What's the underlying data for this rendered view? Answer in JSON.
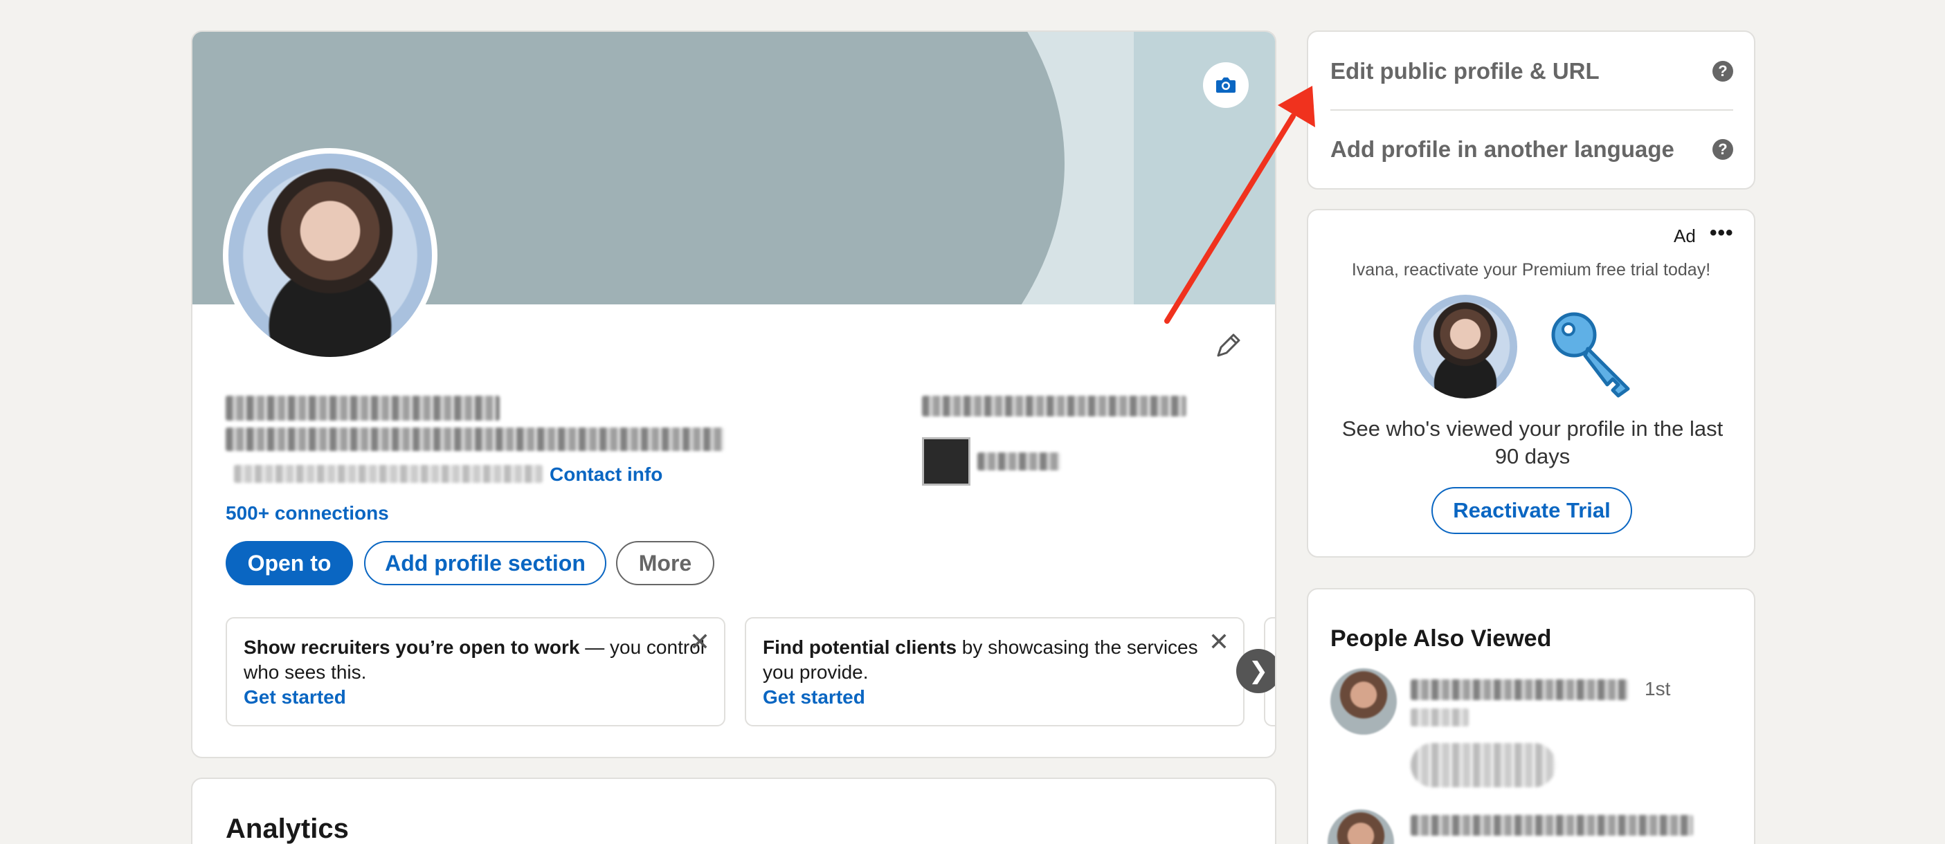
{
  "profile": {
    "contact_info": "Contact info",
    "connections": "500+ connections",
    "buttons": {
      "open_to": "Open to",
      "add_section": "Add profile section",
      "more": "More"
    },
    "promos": [
      {
        "bold": "Show recruiters you’re open to work",
        "rest": " — you control who sees this.",
        "link": "Get started"
      },
      {
        "bold": "Find potential clients",
        "rest": " by showcasing the services you provide.",
        "link": "Get started"
      }
    ],
    "carousel_next": "❯"
  },
  "analytics": {
    "title": "Analytics"
  },
  "profile_links": {
    "edit_public": "Edit public profile & URL",
    "add_language": "Add profile in another language",
    "help_glyph": "?"
  },
  "ad": {
    "label": "Ad",
    "menu": "•••",
    "headline": "Ivana, reactivate your Premium free trial today!",
    "body": "See who's viewed your profile in the last 90 days",
    "cta": "Reactivate Trial"
  },
  "people_also_viewed": {
    "title": "People Also Viewed",
    "first_degree": "1st"
  },
  "colors": {
    "accent": "#0a66c2",
    "annotation_arrow": "#f0321e"
  }
}
